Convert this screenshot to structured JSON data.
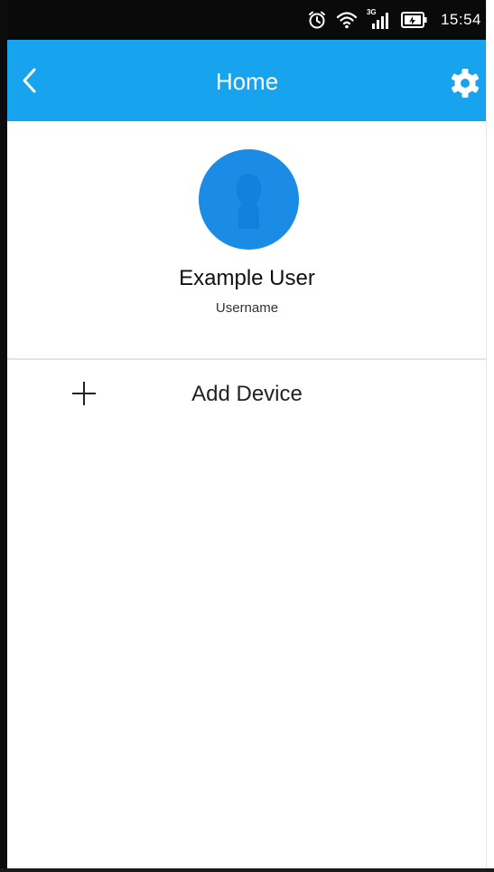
{
  "status_bar": {
    "time": "15:54",
    "network_type": "3G",
    "icons": [
      "alarm-icon",
      "wifi-icon",
      "signal-icon",
      "battery-icon"
    ]
  },
  "app_bar": {
    "title": "Home",
    "back_icon": "chevron-left-icon",
    "settings_icon": "gear-icon",
    "background_color": "#18a3ef"
  },
  "profile": {
    "name": "Example User",
    "username": "Username",
    "avatar_color": "#1a8ce6"
  },
  "actions": {
    "add_device_label": "Add Device",
    "add_device_icon": "plus-icon"
  }
}
